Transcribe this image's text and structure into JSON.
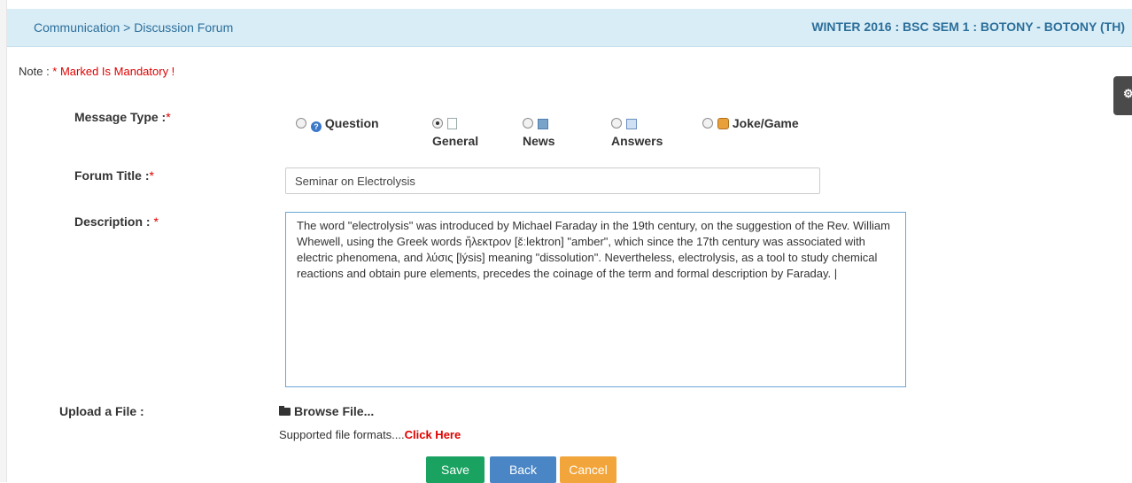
{
  "header": {
    "breadcrumb": "Communication > Discussion Forum",
    "course": "WINTER 2016 : BSC SEM 1 : BOTONY - BOTONY (TH)"
  },
  "note": {
    "prefix": "Note : ",
    "text": "* Marked Is Mandatory !"
  },
  "form": {
    "message_type_label": "Message Type :",
    "forum_title_label": "Forum Title :",
    "description_label": "Description :",
    "upload_label": "Upload a File :",
    "required_mark": "*",
    "message_types": [
      {
        "label": "Question",
        "icon": "question-icon",
        "selected": false
      },
      {
        "label": "General",
        "icon": "document-icon",
        "selected": true
      },
      {
        "label": "News",
        "icon": "news-icon",
        "selected": false
      },
      {
        "label": "Answers",
        "icon": "answers-icon",
        "selected": false
      },
      {
        "label": "Joke/Game",
        "icon": "joke-icon",
        "selected": false
      }
    ],
    "forum_title_value": "Seminar on Electrolysis",
    "description_value": "The word \"electrolysis\" was introduced by Michael Faraday in the 19th century, on the suggestion of the Rev. William Whewell, using the Greek words ἤλεκτρον [ɛ̌ːlektron] \"amber\", which since the 17th century was associated with electric phenomena, and λύσις [lýsis] meaning \"dissolution\". Nevertheless, electrolysis, as a tool to study chemical reactions and obtain pure elements, precedes the coinage of the term and formal description by Faraday. |",
    "browse_label": "Browse File...",
    "formats_text": "Supported file formats....",
    "formats_link": "Click Here"
  },
  "buttons": {
    "save": "Save",
    "back": "Back",
    "cancel": "Cancel"
  },
  "colors": {
    "header_bg": "#d9edf7",
    "link_blue": "#2c6f9a",
    "required_red": "#e00000",
    "save": "#1aa260",
    "back": "#4a86c5",
    "cancel": "#f2a53a"
  }
}
